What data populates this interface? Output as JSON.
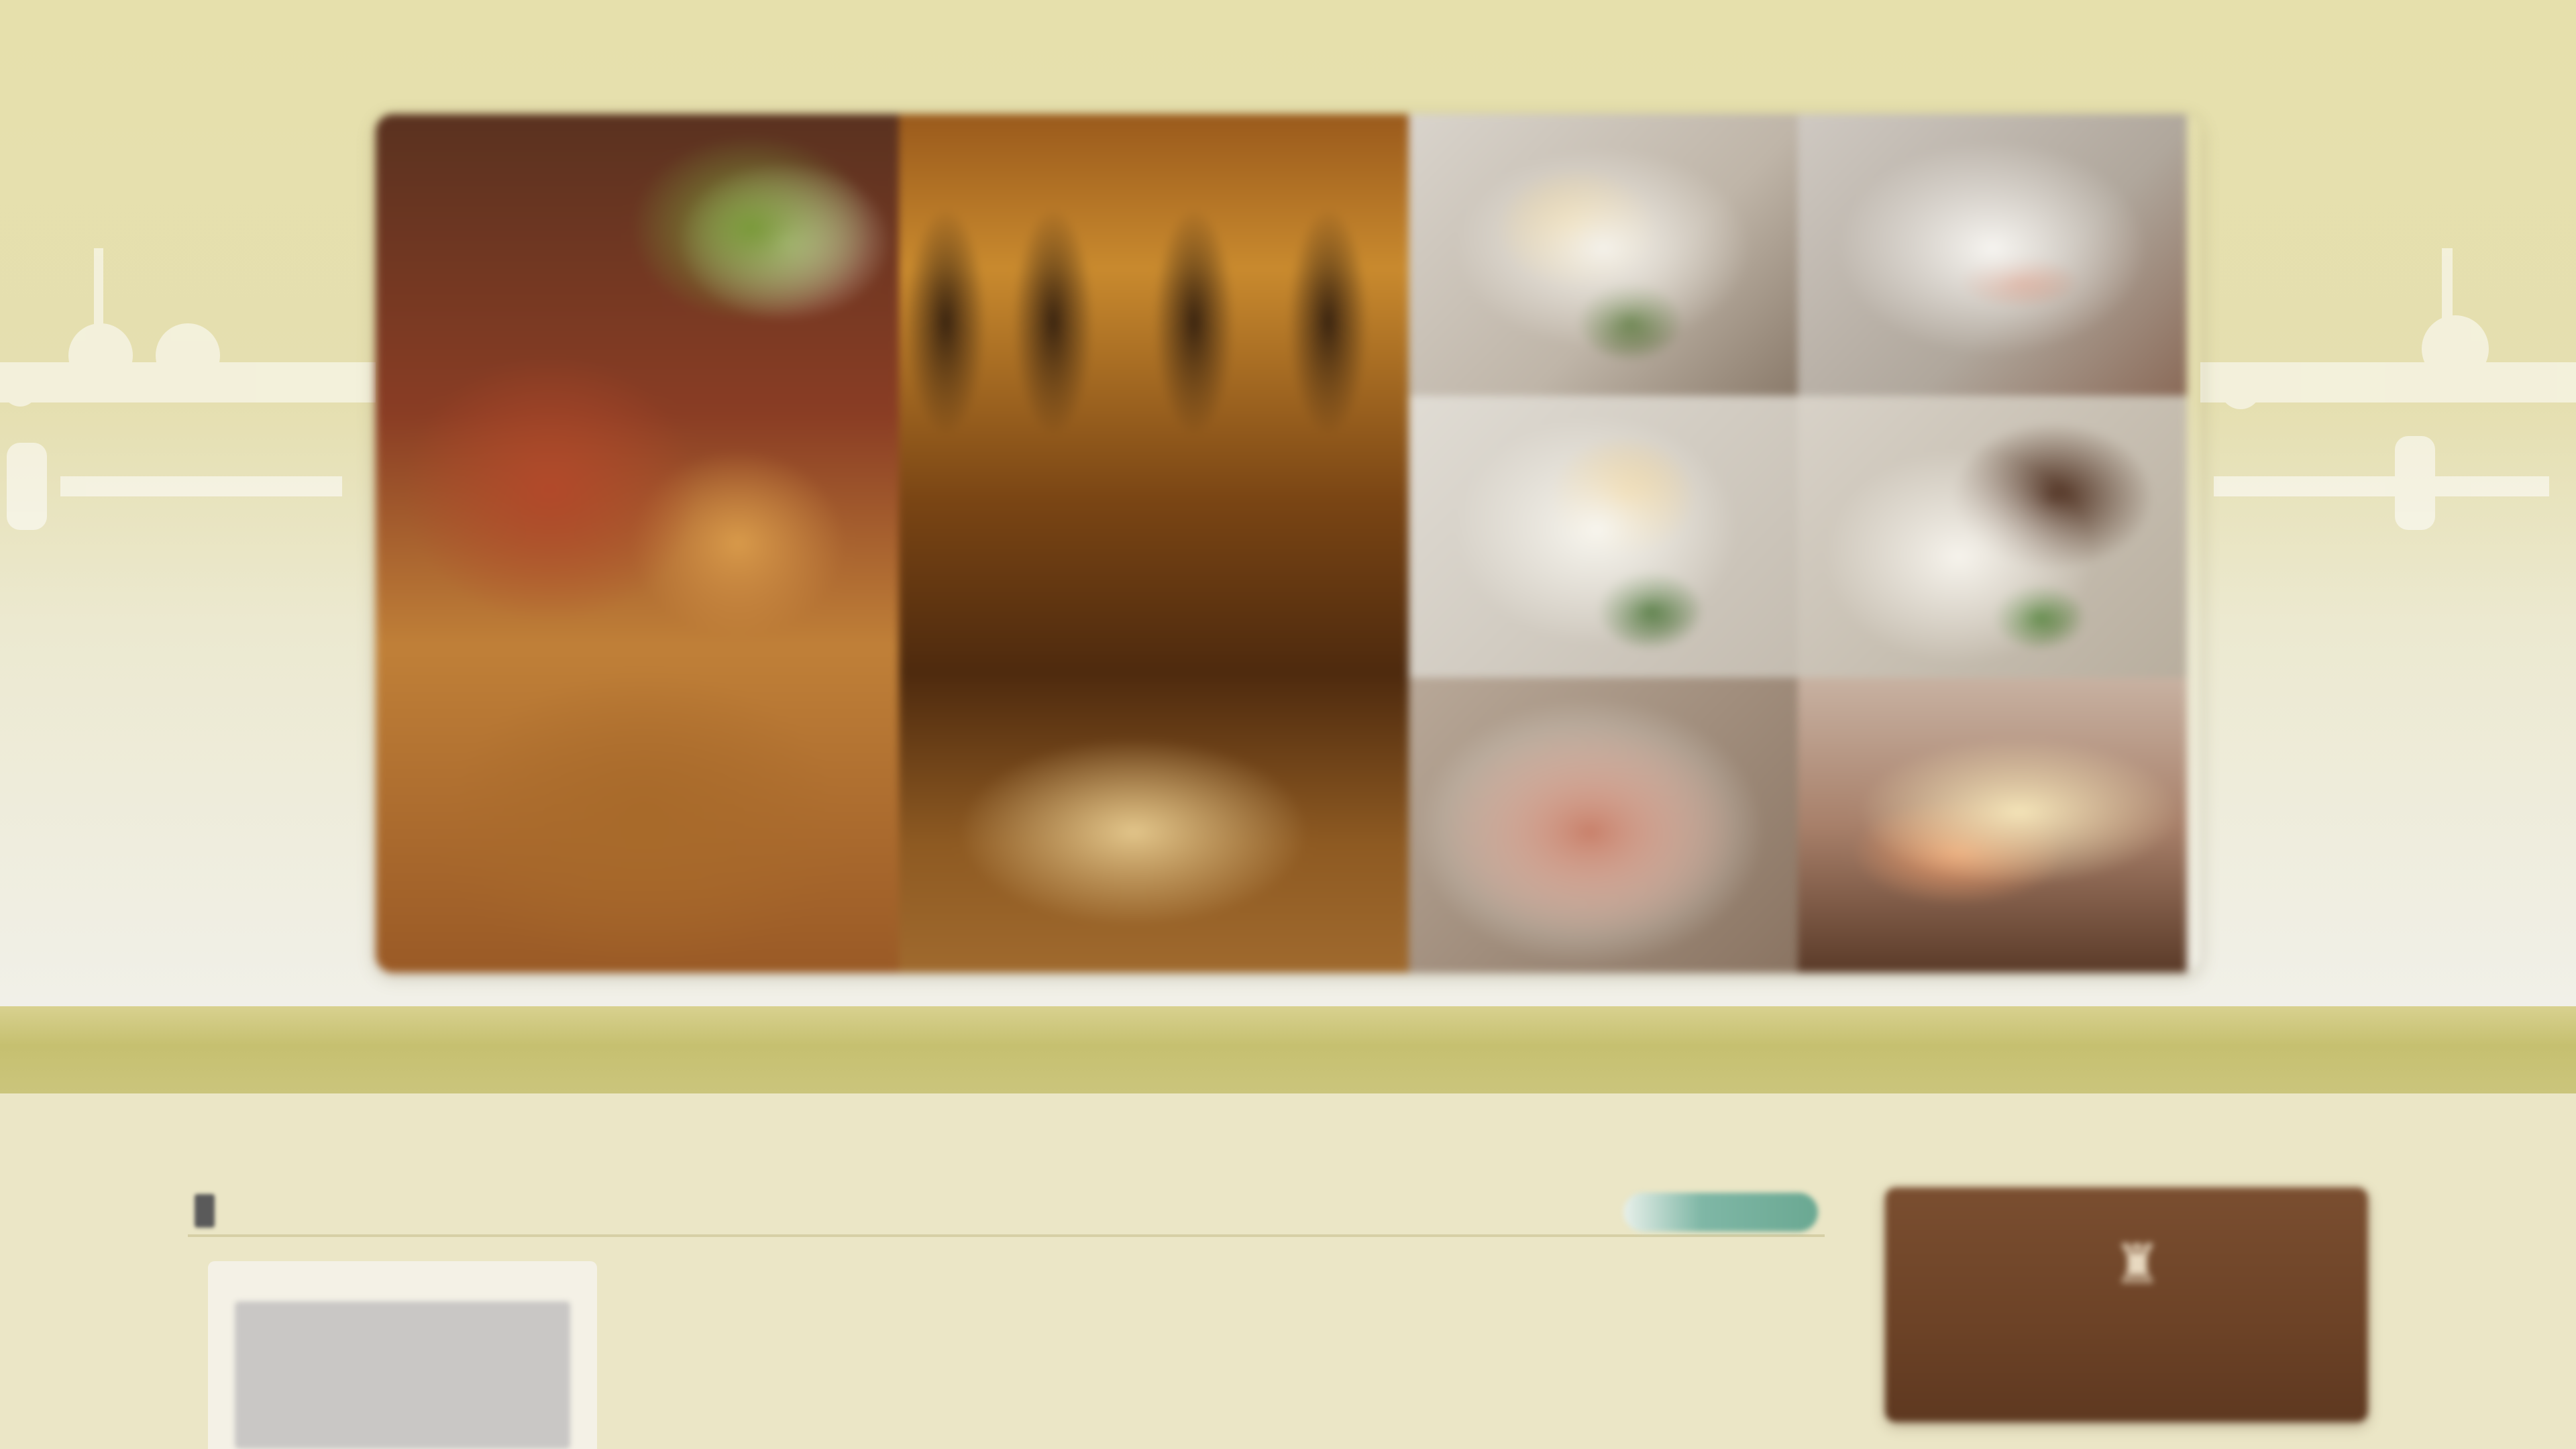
{
  "header": {
    "logo_text": "",
    "top_links_text": ""
  },
  "hero": {
    "photos": [
      {
        "subject": "charcuterie-platter"
      },
      {
        "subject": "wine-bar-interior"
      },
      {
        "subject": "dessert-plate"
      },
      {
        "subject": "dessert-plate"
      },
      {
        "subject": "dessert-plate"
      },
      {
        "subject": "dessert-plate"
      },
      {
        "subject": "dessert-plate"
      },
      {
        "subject": "dessert-plate"
      }
    ]
  },
  "nav": {
    "items": [
      {
        "label": ""
      },
      {
        "label": ""
      },
      {
        "label": ""
      },
      {
        "label": ""
      },
      {
        "label": ""
      },
      {
        "label": ""
      },
      {
        "label": ""
      }
    ]
  },
  "notice": {
    "icon": "document-icon",
    "text": "",
    "more_label": ""
  },
  "brand_card": {
    "emblem": "bottle-emblem-icon",
    "name": ""
  },
  "colors": {
    "nav_band": "#c6c070",
    "page_bg": "#ebe6c6",
    "brand_card": "#6c4226",
    "more_button": "#6aa892"
  }
}
